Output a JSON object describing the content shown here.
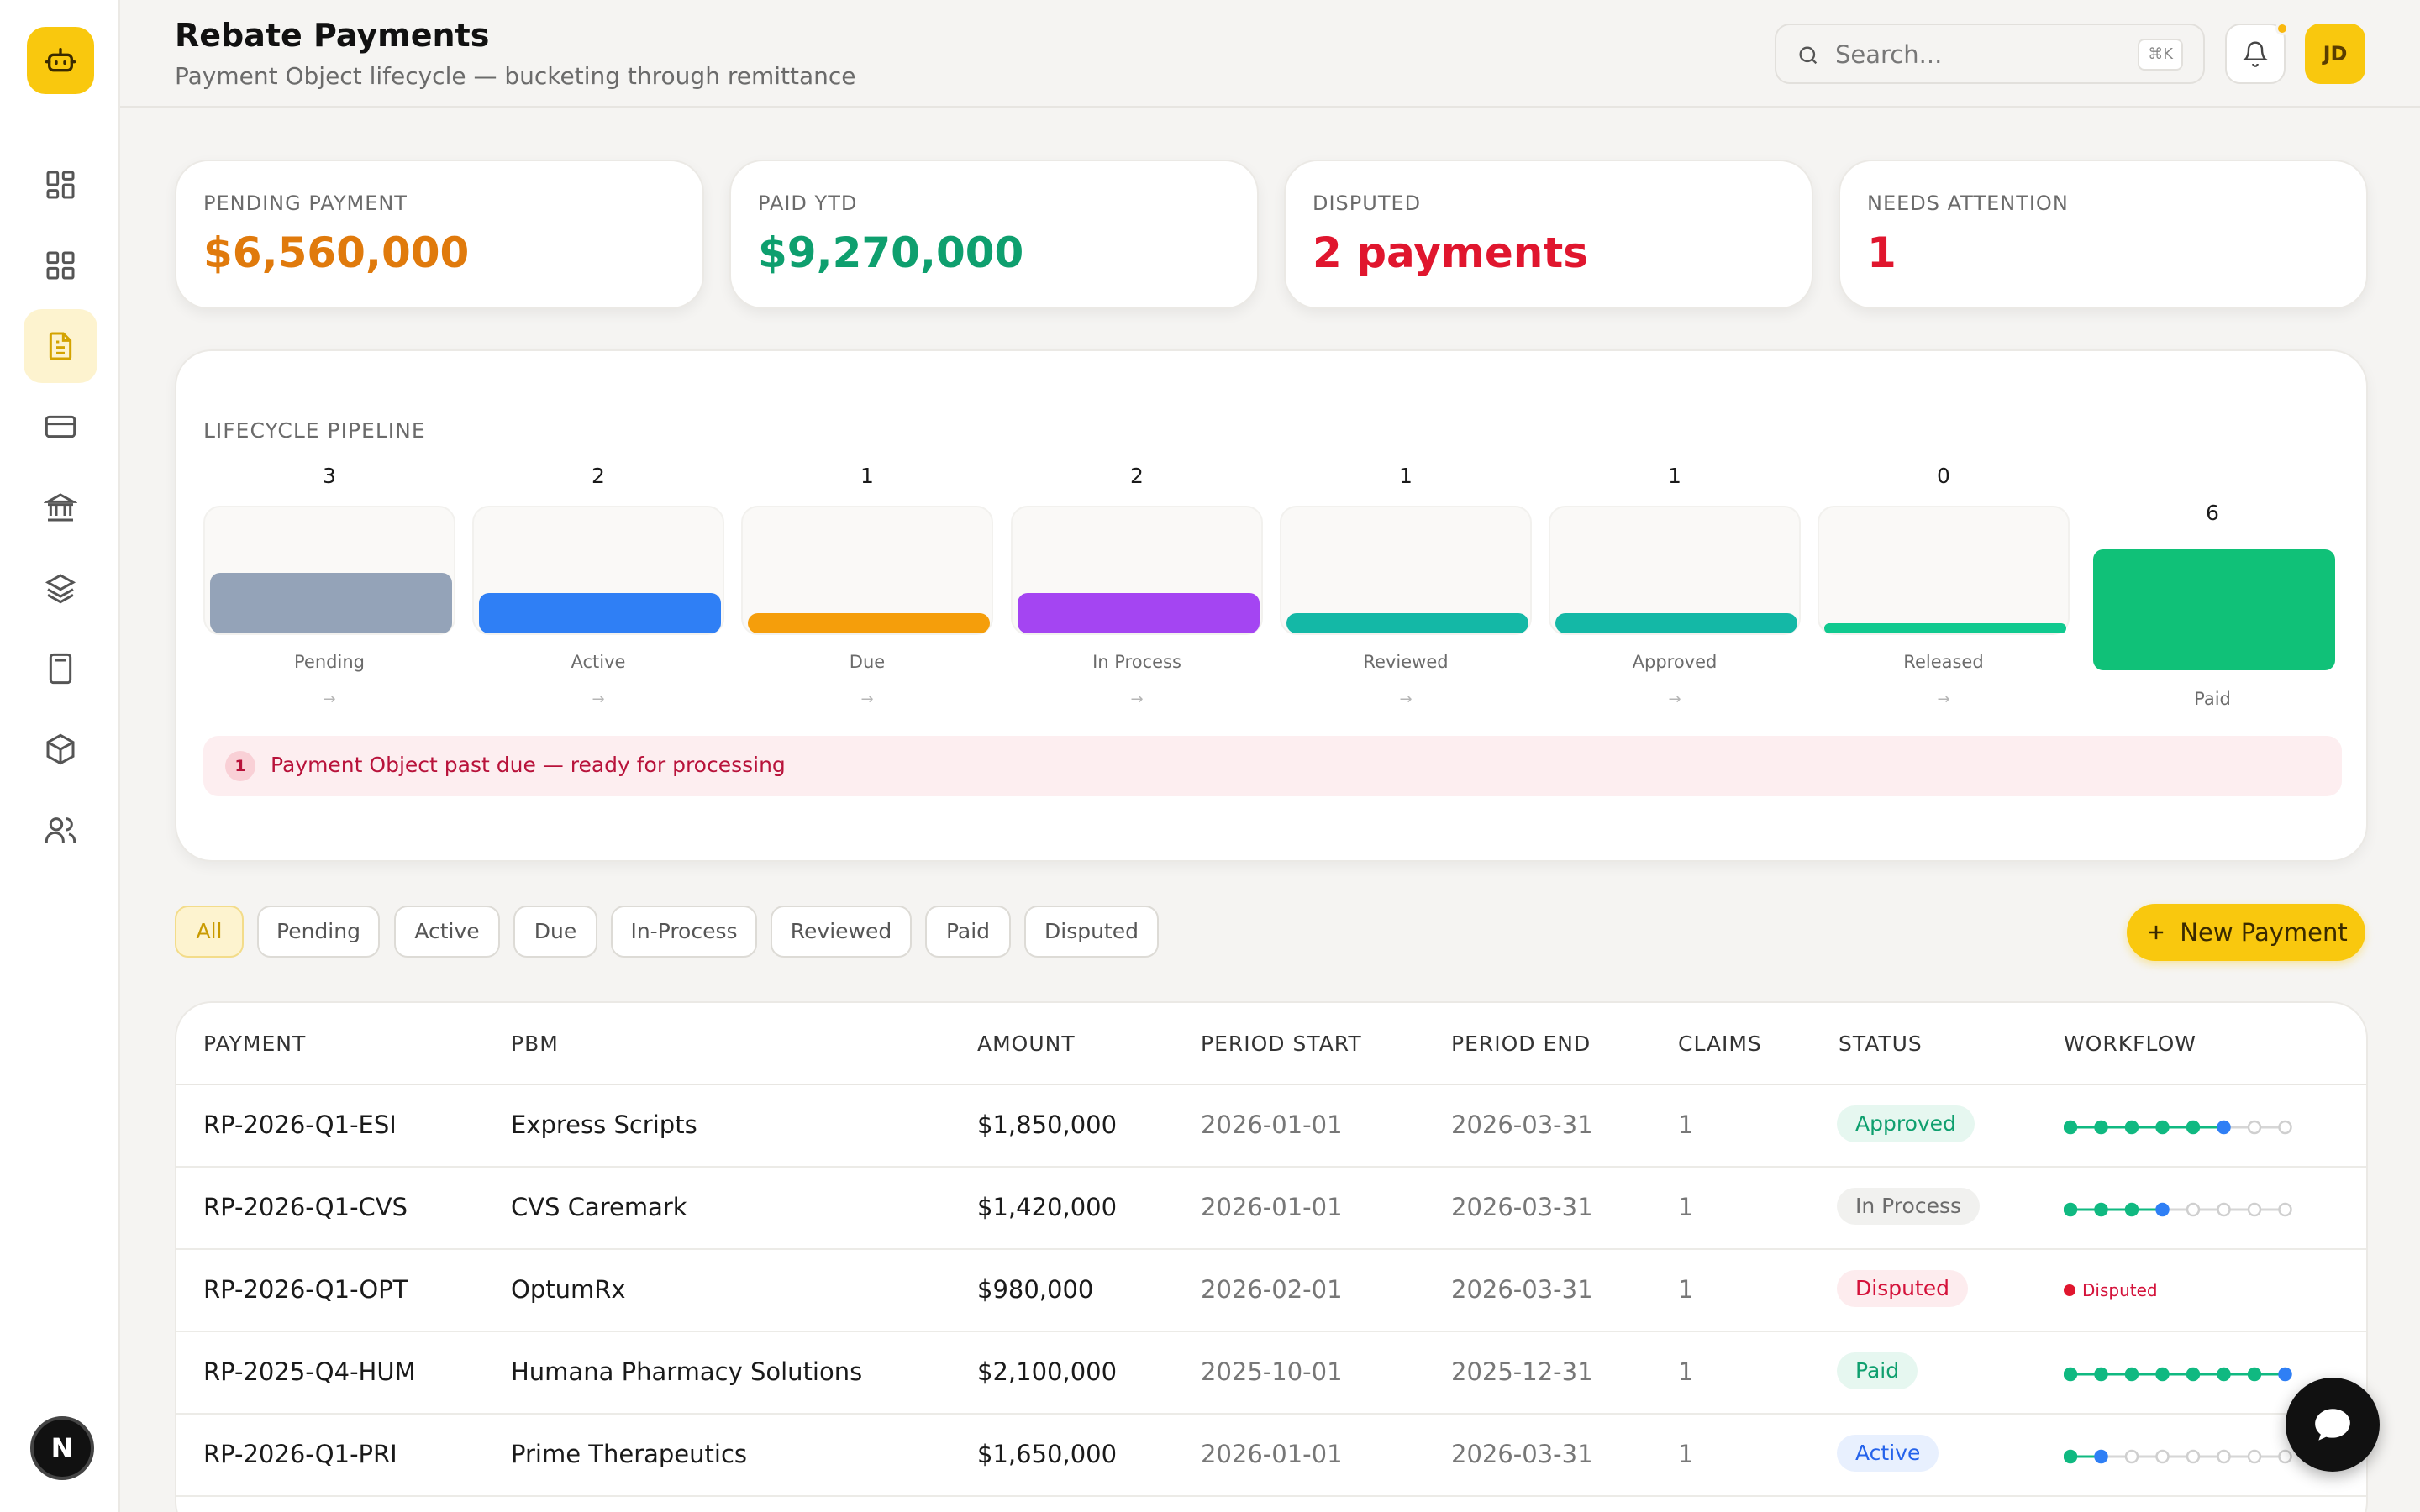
{
  "app": {
    "logo_icon": "bot-icon",
    "brand_color": "#f9c80e"
  },
  "sidebar": {
    "items": [
      {
        "icon": "dashboard-icon",
        "active": false
      },
      {
        "icon": "grid-icon",
        "active": false
      },
      {
        "icon": "document-icon",
        "active": true
      },
      {
        "icon": "credit-card-icon",
        "active": false
      },
      {
        "icon": "bank-icon",
        "active": false
      },
      {
        "icon": "layers-icon",
        "active": false
      },
      {
        "icon": "calculator-icon",
        "active": false
      },
      {
        "icon": "package-icon",
        "active": false
      },
      {
        "icon": "users-icon",
        "active": false
      }
    ],
    "footer_avatar": "N"
  },
  "header": {
    "title": "Rebate Payments",
    "subtitle": "Payment Object lifecycle — bucketing through remittance",
    "search_placeholder": "Search...",
    "search_shortcut": "⌘K",
    "user_initials": "JD"
  },
  "stats": [
    {
      "label": "PENDING PAYMENT",
      "value": "$6,560,000",
      "color": "#e07a0c"
    },
    {
      "label": "PAID YTD",
      "value": "$9,270,000",
      "color": "#0e9f6e"
    },
    {
      "label": "DISPUTED",
      "value": "2 payments",
      "color": "#e0162e"
    },
    {
      "label": "NEEDS ATTENTION",
      "value": "1",
      "color": "#e0162e"
    }
  ],
  "pipeline": {
    "label": "LIFECYCLE PIPELINE",
    "stages": [
      {
        "name": "Pending",
        "count": "3",
        "color": "#94a3b8",
        "arrow": "→"
      },
      {
        "name": "Active",
        "count": "2",
        "color": "#2f7ff5",
        "arrow": "→"
      },
      {
        "name": "Due",
        "count": "1",
        "color": "#f59e0b",
        "arrow": "→"
      },
      {
        "name": "In Process",
        "count": "2",
        "color": "#a445f2",
        "arrow": "→"
      },
      {
        "name": "Reviewed",
        "count": "1",
        "color": "#14b8a6",
        "arrow": "→"
      },
      {
        "name": "Approved",
        "count": "1",
        "color": "#14b8a6",
        "arrow": "→"
      },
      {
        "name": "Released",
        "count": "0",
        "color": "#10c98f",
        "arrow": "→"
      },
      {
        "name": "Paid",
        "count": "6",
        "color": "#10c178",
        "arrow": ""
      }
    ],
    "alert_count": "1",
    "alert_text": "Payment Object past due — ready for processing"
  },
  "filters": {
    "tabs": [
      "All",
      "Pending",
      "Active",
      "Due",
      "In-Process",
      "Reviewed",
      "Paid",
      "Disputed"
    ],
    "active": "All",
    "new_button": "New Payment"
  },
  "table": {
    "columns": [
      "PAYMENT",
      "PBM",
      "AMOUNT",
      "PERIOD START",
      "PERIOD END",
      "CLAIMS",
      "STATUS",
      "WORKFLOW"
    ],
    "rows": [
      {
        "payment": "RP-2026-Q1-ESI",
        "pbm": "Express Scripts",
        "amount": "$1,850,000",
        "start": "2026-01-01",
        "end": "2026-03-31",
        "claims": "1",
        "status": "Approved",
        "workflow_step": 6,
        "disputed": false
      },
      {
        "payment": "RP-2026-Q1-CVS",
        "pbm": "CVS Caremark",
        "amount": "$1,420,000",
        "start": "2026-01-01",
        "end": "2026-03-31",
        "claims": "1",
        "status": "In Process",
        "workflow_step": 4,
        "disputed": false
      },
      {
        "payment": "RP-2026-Q1-OPT",
        "pbm": "OptumRx",
        "amount": "$980,000",
        "start": "2026-02-01",
        "end": "2026-03-31",
        "claims": "1",
        "status": "Disputed",
        "workflow_step": 0,
        "disputed": true,
        "workflow_label": "Disputed"
      },
      {
        "payment": "RP-2025-Q4-HUM",
        "pbm": "Humana Pharmacy Solutions",
        "amount": "$2,100,000",
        "start": "2025-10-01",
        "end": "2025-12-31",
        "claims": "1",
        "status": "Paid",
        "workflow_step": 8,
        "disputed": false
      },
      {
        "payment": "RP-2026-Q1-PRI",
        "pbm": "Prime Therapeutics",
        "amount": "$1,650,000",
        "start": "2026-01-01",
        "end": "2026-03-31",
        "claims": "1",
        "status": "Active",
        "workflow_step": 2,
        "disputed": false
      }
    ]
  },
  "status_colors": {
    "Approved": {
      "bg": "#e6f7f0",
      "fg": "#0e9f6e"
    },
    "In Process": {
      "bg": "#f1f1ef",
      "fg": "#6b6b6b"
    },
    "Disputed": {
      "bg": "#fdecee",
      "fg": "#d4123a"
    },
    "Paid": {
      "bg": "#e6f7f0",
      "fg": "#0e9f6e"
    },
    "Active": {
      "bg": "#e8f0fe",
      "fg": "#2563eb"
    }
  },
  "chat_icon": "chat-bubble-icon"
}
